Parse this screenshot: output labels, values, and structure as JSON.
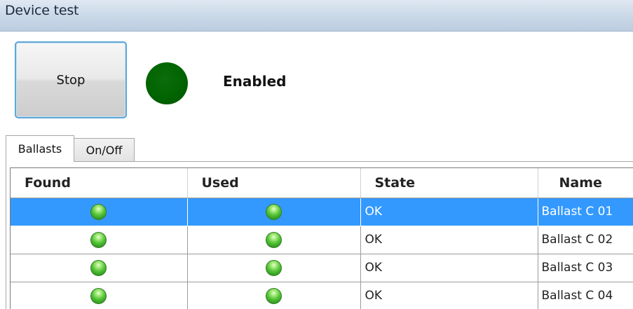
{
  "window": {
    "title": "Device test"
  },
  "controls": {
    "stop_label": "Stop",
    "status_text": "Enabled",
    "status_color": "#006400"
  },
  "tabs": [
    {
      "label": "Ballasts",
      "active": true
    },
    {
      "label": "On/Off",
      "active": false
    }
  ],
  "grid": {
    "columns": [
      "Found",
      "Used",
      "State",
      "Name"
    ],
    "rows": [
      {
        "found": "green-led-icon",
        "used": "green-led-icon",
        "state": "OK",
        "name": "Ballast C 01",
        "selected": true
      },
      {
        "found": "green-led-icon",
        "used": "green-led-icon",
        "state": "OK",
        "name": "Ballast C 02",
        "selected": false
      },
      {
        "found": "green-led-icon",
        "used": "green-led-icon",
        "state": "OK",
        "name": "Ballast C 03",
        "selected": false
      },
      {
        "found": "green-led-icon",
        "used": "green-led-icon",
        "state": "OK",
        "name": "Ballast C 04",
        "selected": false
      }
    ],
    "selection_color": "#3399ff",
    "led_color": "#52c236"
  }
}
